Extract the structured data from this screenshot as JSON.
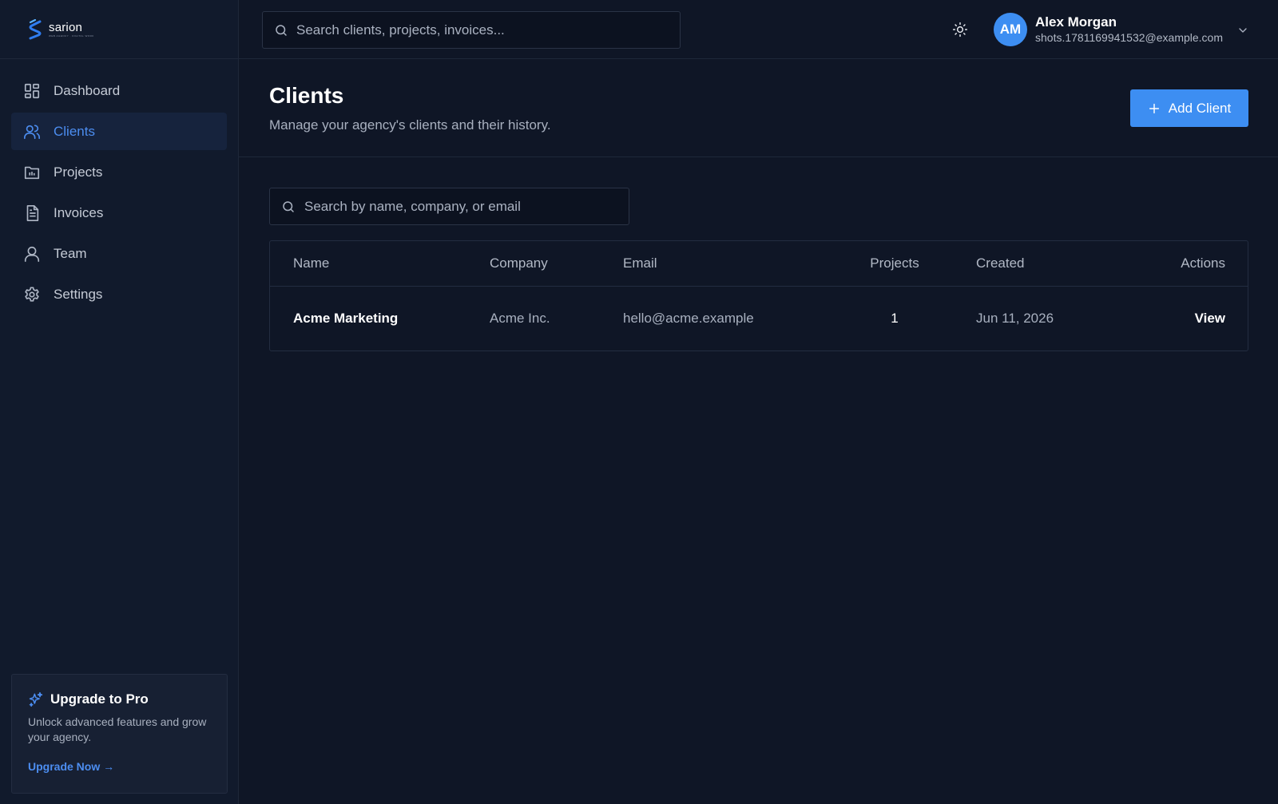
{
  "brand": {
    "name": "sarion",
    "tagline": "WEB AGENCY · DIGITAL WORK",
    "accent_color": "#3d8ef2"
  },
  "sidebar": {
    "items": [
      {
        "label": "Dashboard",
        "icon": "dashboard-icon",
        "active": false
      },
      {
        "label": "Clients",
        "icon": "users-icon",
        "active": true
      },
      {
        "label": "Projects",
        "icon": "folder-icon",
        "active": false
      },
      {
        "label": "Invoices",
        "icon": "invoice-icon",
        "active": false
      },
      {
        "label": "Team",
        "icon": "user-icon",
        "active": false
      },
      {
        "label": "Settings",
        "icon": "gear-icon",
        "active": false
      }
    ],
    "upgrade": {
      "title": "Upgrade to Pro",
      "description": "Unlock advanced features and grow your agency.",
      "link": "Upgrade Now →",
      "icon": "sparkles-icon"
    }
  },
  "topbar": {
    "search_placeholder": "Search clients, projects, invoices...",
    "theme_icon": "sun-icon",
    "user": {
      "initials": "AM",
      "name": "Alex Morgan",
      "email": "shots.1781169941532@example.com"
    }
  },
  "page": {
    "title": "Clients",
    "subtitle": "Manage your agency's clients and their history.",
    "add_button": "Add Client"
  },
  "filter": {
    "placeholder": "Search by name, company, or email"
  },
  "table": {
    "headers": {
      "name": "Name",
      "company": "Company",
      "email": "Email",
      "projects": "Projects",
      "created": "Created",
      "actions": "Actions"
    },
    "rows": [
      {
        "name": "Acme Marketing",
        "company": "Acme Inc.",
        "email": "hello@acme.example",
        "projects": "1",
        "created": "Jun 11, 2026",
        "action": "View"
      }
    ]
  }
}
